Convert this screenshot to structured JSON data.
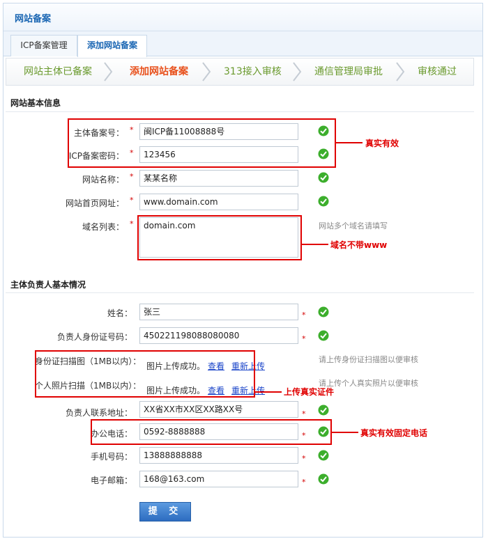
{
  "page": {
    "title": "网站备案"
  },
  "tabs": [
    {
      "label": "ICP备案管理",
      "active": false
    },
    {
      "label": "添加网站备案",
      "active": true
    }
  ],
  "steps": [
    {
      "label": "网站主体已备案"
    },
    {
      "label": "添加网站备案"
    },
    {
      "label": "313接入审核"
    },
    {
      "label": "通信管理局审批"
    },
    {
      "label": "审核通过"
    }
  ],
  "section1": {
    "title": "网站基本信息",
    "fields": {
      "subject_no": {
        "label": "主体备案号：",
        "value": "闽ICP备11008888号"
      },
      "icp_password": {
        "label": "ICP备案密码：",
        "value": "123456"
      },
      "site_name": {
        "label": "网站名称：",
        "value": "某某名称"
      },
      "homepage": {
        "label": "网站首页网址：",
        "value": "www.domain.com"
      },
      "domains": {
        "label": "域名列表：",
        "value": "domain.com",
        "hint": "网站多个域名请填写"
      }
    }
  },
  "section2": {
    "title": "主体负责人基本情况",
    "fields": {
      "name": {
        "label": "姓名：",
        "value": "张三"
      },
      "id_no": {
        "label": "负责人身份证号码：",
        "value": "450221198088080080"
      },
      "id_scan": {
        "label": "身份证扫描图（1MB以内）：",
        "status": "图片上传成功。",
        "view": "查看",
        "reupload": "重新上传",
        "hint": "请上传身份证扫描图以便审核"
      },
      "photo_scan": {
        "label": "个人照片扫描（1MB以内）：",
        "status": "图片上传成功。",
        "view": "查看",
        "reupload": "重新上传",
        "hint": "请上传个人真实照片以便审核"
      },
      "address": {
        "label": "负责人联系地址：",
        "value": "XX省XX市XX区XX路XX号"
      },
      "office_phone": {
        "label": "办公电话：",
        "value": "0592-8888888"
      },
      "mobile": {
        "label": "手机号码：",
        "value": "13888888888"
      },
      "email": {
        "label": "电子邮箱：",
        "value": "168@163.com"
      }
    }
  },
  "submit_label": "提 交",
  "annotations": {
    "valid": "真实有效",
    "no_www": "域名不带www",
    "upload_real": "上传真实证件",
    "real_phone": "真实有效固定电话"
  },
  "colors": {
    "accent": "#1a66b3",
    "current_step": "#e8501b",
    "done_step": "#6a9a2e",
    "annotation": "#e00000",
    "ok": "#3cae2c"
  }
}
